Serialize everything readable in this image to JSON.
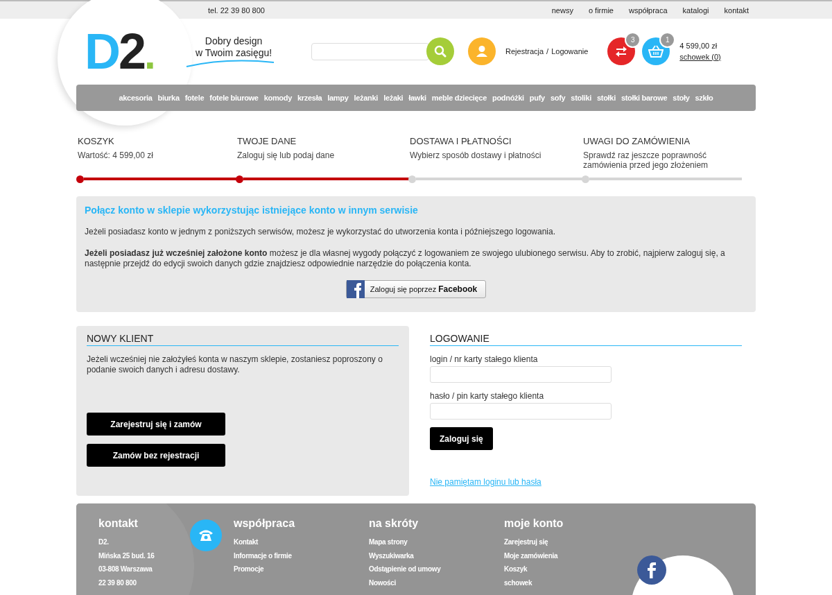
{
  "top_bar": {
    "phone": "tel. 22 39 80 800",
    "links": [
      "newsy",
      "o firmie",
      "współpraca",
      "katalogi",
      "kontakt"
    ]
  },
  "header": {
    "logo": {
      "first": "D",
      "second": "2",
      "dot": "."
    },
    "tagline": [
      "Dobry design",
      "w Twoim zasięgu!"
    ],
    "account": {
      "register": "Rejestracja",
      "separator": "/",
      "login": "Logowanie"
    },
    "compare": {
      "count": "3"
    },
    "cart": {
      "count": "1",
      "total": "4 599,00 zł",
      "clipboard": "schowek (0)"
    }
  },
  "categories": [
    "akcesoria",
    "biurka",
    "fotele",
    "fotele biurowe",
    "komody",
    "krzesła",
    "lampy",
    "leżanki",
    "leżaki",
    "ławki",
    "meble dziecięce",
    "podnóżki",
    "pufy",
    "sofy",
    "stoliki",
    "stołki",
    "stołki barowe",
    "stoły",
    "szkło"
  ],
  "steps": [
    {
      "title": "KOSZYK",
      "description": "Wartość: 4 599,00 zł",
      "completed": true
    },
    {
      "title": "TWOJE DANE",
      "description": "Zaloguj się lub podaj dane",
      "completed": true
    },
    {
      "title": "DOSTAWA I PŁATNOŚCI",
      "description": "Wybierz sposób dostawy i płatności",
      "completed": false
    },
    {
      "title": "UWAGI DO ZAMÓWIENIA",
      "description": "Sprawdź raz jeszcze poprawność zamówienia przed jego złożeniem",
      "completed": false
    }
  ],
  "connect": {
    "title": "Połącz konto w sklepie wykorzystując istniejące konto w innym serwisie",
    "paragraphs": [
      "Jeżeli posiadasz konto w jednym z poniższych serwisów, możesz je wykorzystać do utworzenia konta i późniejszego logowania.",
      "**Jeżeli posiadasz już wcześniej założone konto** możesz je dla własnej wygody połączyć z logowaniem ze swojego ulubionego serwisu. Aby to zrobić, najpierw zaloguj się, a następnie przejdź do edycji swoich danych gdzie znajdziesz odpowiednie narzędzie do połączenia konta."
    ],
    "facebook_button": "Zaloguj się poprzez **Facebook**"
  },
  "new_customer": {
    "title": "NOWY KLIENT",
    "text": "Jeżeli wcześniej nie założyłeś konta w naszym sklepie, zostaniesz poproszony o podanie swoich danych i adresu dostawy.",
    "buttons": [
      "Zarejestruj się i zamów",
      "Zamów bez rejestracji"
    ]
  },
  "login": {
    "title": "LOGOWANIE",
    "fields": [
      {
        "label": "login / nr karty stałego klienta"
      },
      {
        "label": "hasło / pin karty stałego klienta"
      }
    ],
    "submit": "Zaloguj się",
    "forgot_link": "Nie pamiętam loginu lub hasła"
  },
  "footer": {
    "columns": [
      {
        "title": "kontakt",
        "items": [
          "D2.",
          "Mińska 25 bud. 16",
          "03-808 Warszawa",
          "22 39 80 800"
        ]
      },
      {
        "title": "współpraca",
        "items": [
          "Kontakt",
          "Informacje o firmie",
          "Promocje"
        ]
      },
      {
        "title": "na skróty",
        "items": [
          "Mapa strony",
          "Wyszukiwarka",
          "Odstąpienie od umowy",
          "Nowości"
        ]
      },
      {
        "title": "moje konto",
        "items": [
          "Zarejestruj się",
          "Moje zamówienia",
          "Koszyk",
          "schowek"
        ]
      }
    ]
  }
}
